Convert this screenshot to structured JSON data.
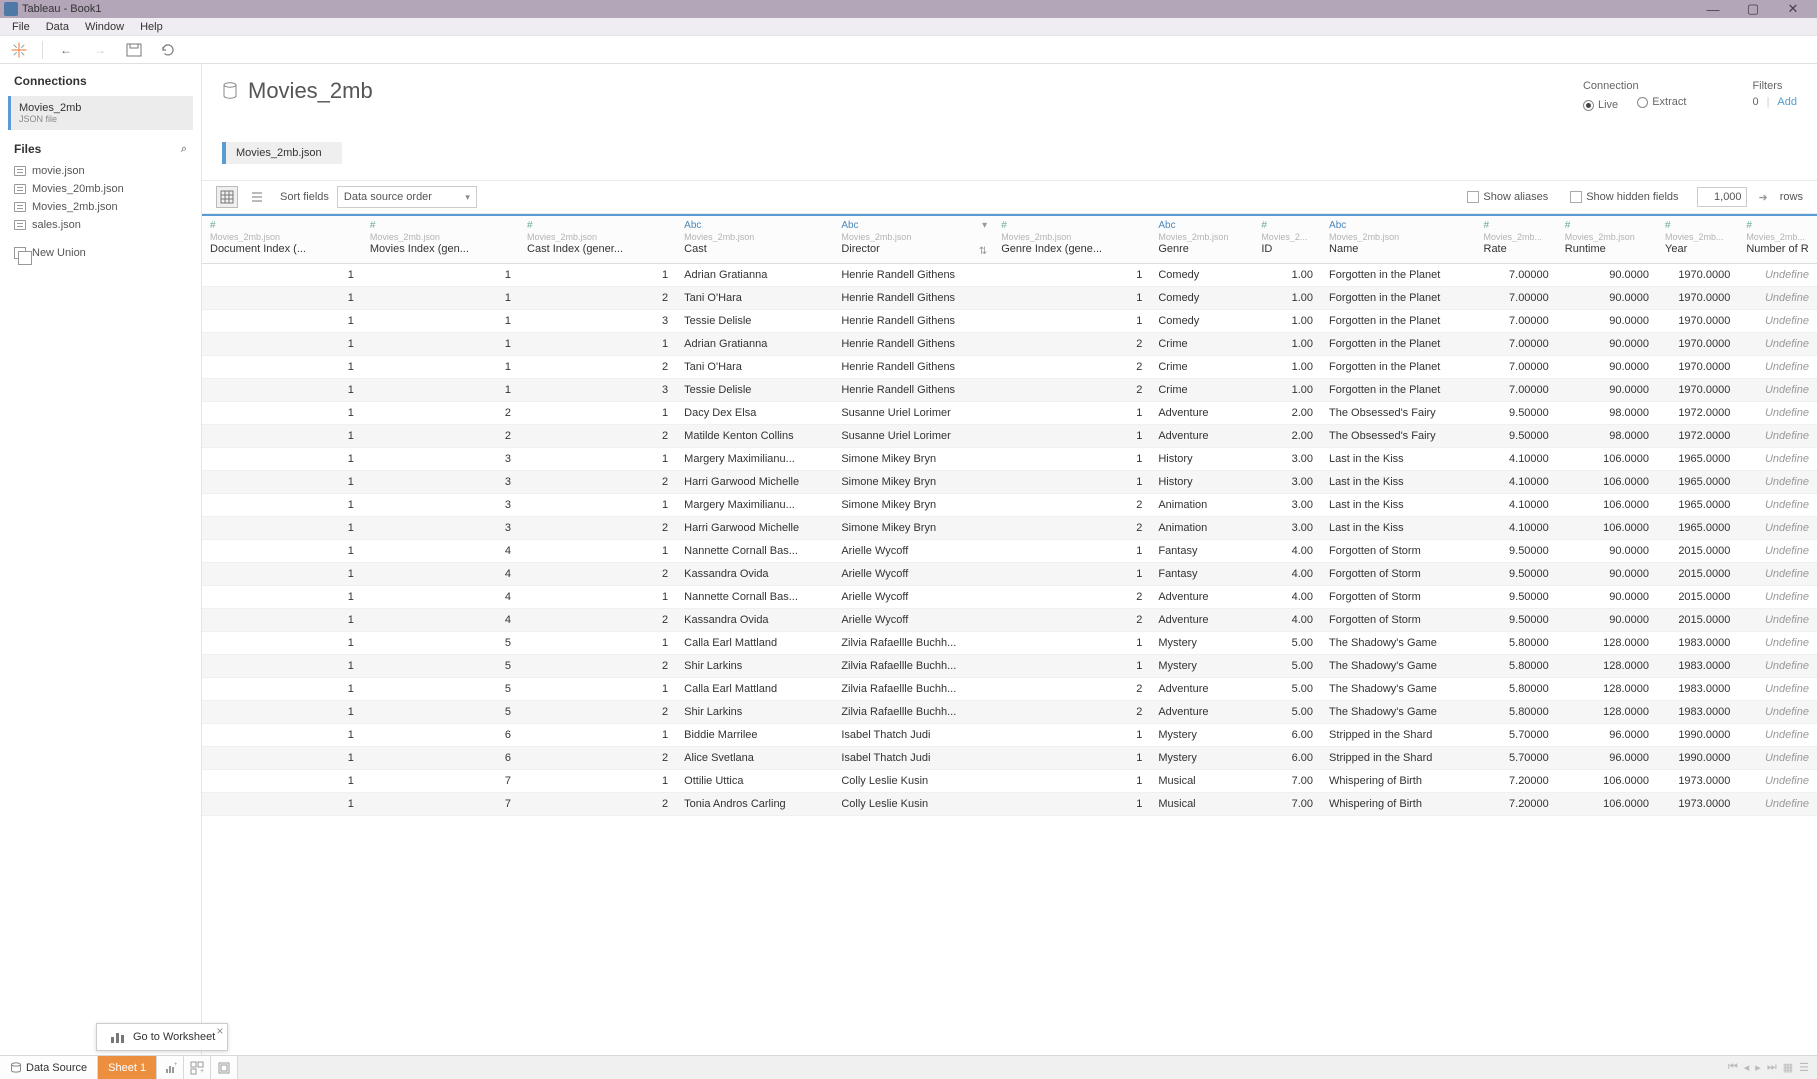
{
  "titlebar": {
    "title": "Tableau - Book1"
  },
  "menubar": [
    "File",
    "Data",
    "Window",
    "Help"
  ],
  "sidebar": {
    "connections_label": "Connections",
    "connection": {
      "name": "Movies_2mb",
      "sub": "JSON file"
    },
    "files_label": "Files",
    "files": [
      "movie.json",
      "Movies_20mb.json",
      "Movies_2mb.json",
      "sales.json"
    ],
    "new_union": "New Union"
  },
  "canvas": {
    "title": "Movies_2mb",
    "connection_label": "Connection",
    "conn_live": "Live",
    "conn_extract": "Extract",
    "filters_label": "Filters",
    "filters_count": "0",
    "filters_add": "Add",
    "file_pill": "Movies_2mb.json"
  },
  "options": {
    "sort_fields": "Sort fields",
    "sort_value": "Data source order",
    "show_aliases": "Show aliases",
    "show_hidden": "Show hidden fields",
    "rows_value": "1,000",
    "rows_label": "rows"
  },
  "columns": [
    {
      "type": "num",
      "src": "Movies_2mb.json",
      "name": "Document Index (...",
      "align": "num",
      "cls": "c-docidx"
    },
    {
      "type": "num",
      "src": "Movies_2mb.json",
      "name": "Movies Index (gen...",
      "align": "num",
      "cls": "c-movidx"
    },
    {
      "type": "num",
      "src": "Movies_2mb.json",
      "name": "Cast Index (gener...",
      "align": "num",
      "cls": "c-castidx"
    },
    {
      "type": "str",
      "src": "Movies_2mb.json",
      "name": "Cast",
      "align": "txt",
      "cls": "c-cast"
    },
    {
      "type": "str",
      "src": "Movies_2mb.json",
      "name": "Director",
      "align": "txt",
      "cls": "c-director",
      "dropdown": true,
      "sort": true
    },
    {
      "type": "num",
      "src": "Movies_2mb.json",
      "name": "Genre Index (gene...",
      "align": "num",
      "cls": "c-genreidx"
    },
    {
      "type": "str",
      "src": "Movies_2mb.json",
      "name": "Genre",
      "align": "txt",
      "cls": "c-genre"
    },
    {
      "type": "num",
      "src": "Movies_2...",
      "name": "ID",
      "align": "num",
      "cls": "c-id"
    },
    {
      "type": "str",
      "src": "Movies_2mb.json",
      "name": "Name",
      "align": "txt",
      "cls": "c-name"
    },
    {
      "type": "num",
      "src": "Movies_2mb...",
      "name": "Rate",
      "align": "num",
      "cls": "c-rate"
    },
    {
      "type": "num",
      "src": "Movies_2mb.json",
      "name": "Runtime",
      "align": "num",
      "cls": "c-runtime"
    },
    {
      "type": "num",
      "src": "Movies_2mb...",
      "name": "Year",
      "align": "num",
      "cls": "c-year"
    },
    {
      "type": "num",
      "src": "Movies_2mb...",
      "name": "Number of R",
      "align": "num",
      "cls": "c-numr"
    }
  ],
  "rows": [
    [
      "1",
      "1",
      "1",
      "Adrian Gratianna",
      "Henrie Randell Githens",
      "1",
      "Comedy",
      "1.00",
      "Forgotten in the Planet",
      "7.00000",
      "90.0000",
      "1970.0000",
      "Undefine"
    ],
    [
      "1",
      "1",
      "2",
      "Tani O'Hara",
      "Henrie Randell Githens",
      "1",
      "Comedy",
      "1.00",
      "Forgotten in the Planet",
      "7.00000",
      "90.0000",
      "1970.0000",
      "Undefine"
    ],
    [
      "1",
      "1",
      "3",
      "Tessie Delisle",
      "Henrie Randell Githens",
      "1",
      "Comedy",
      "1.00",
      "Forgotten in the Planet",
      "7.00000",
      "90.0000",
      "1970.0000",
      "Undefine"
    ],
    [
      "1",
      "1",
      "1",
      "Adrian Gratianna",
      "Henrie Randell Githens",
      "2",
      "Crime",
      "1.00",
      "Forgotten in the Planet",
      "7.00000",
      "90.0000",
      "1970.0000",
      "Undefine"
    ],
    [
      "1",
      "1",
      "2",
      "Tani O'Hara",
      "Henrie Randell Githens",
      "2",
      "Crime",
      "1.00",
      "Forgotten in the Planet",
      "7.00000",
      "90.0000",
      "1970.0000",
      "Undefine"
    ],
    [
      "1",
      "1",
      "3",
      "Tessie Delisle",
      "Henrie Randell Githens",
      "2",
      "Crime",
      "1.00",
      "Forgotten in the Planet",
      "7.00000",
      "90.0000",
      "1970.0000",
      "Undefine"
    ],
    [
      "1",
      "2",
      "1",
      "Dacy Dex Elsa",
      "Susanne Uriel Lorimer",
      "1",
      "Adventure",
      "2.00",
      "The Obsessed's Fairy",
      "9.50000",
      "98.0000",
      "1972.0000",
      "Undefine"
    ],
    [
      "1",
      "2",
      "2",
      "Matilde Kenton Collins",
      "Susanne Uriel Lorimer",
      "1",
      "Adventure",
      "2.00",
      "The Obsessed's Fairy",
      "9.50000",
      "98.0000",
      "1972.0000",
      "Undefine"
    ],
    [
      "1",
      "3",
      "1",
      "Margery Maximilianu...",
      "Simone Mikey Bryn",
      "1",
      "History",
      "3.00",
      "Last in the Kiss",
      "4.10000",
      "106.0000",
      "1965.0000",
      "Undefine"
    ],
    [
      "1",
      "3",
      "2",
      "Harri Garwood Michelle",
      "Simone Mikey Bryn",
      "1",
      "History",
      "3.00",
      "Last in the Kiss",
      "4.10000",
      "106.0000",
      "1965.0000",
      "Undefine"
    ],
    [
      "1",
      "3",
      "1",
      "Margery Maximilianu...",
      "Simone Mikey Bryn",
      "2",
      "Animation",
      "3.00",
      "Last in the Kiss",
      "4.10000",
      "106.0000",
      "1965.0000",
      "Undefine"
    ],
    [
      "1",
      "3",
      "2",
      "Harri Garwood Michelle",
      "Simone Mikey Bryn",
      "2",
      "Animation",
      "3.00",
      "Last in the Kiss",
      "4.10000",
      "106.0000",
      "1965.0000",
      "Undefine"
    ],
    [
      "1",
      "4",
      "1",
      "Nannette Cornall Bas...",
      "Arielle Wycoff",
      "1",
      "Fantasy",
      "4.00",
      "Forgotten of Storm",
      "9.50000",
      "90.0000",
      "2015.0000",
      "Undefine"
    ],
    [
      "1",
      "4",
      "2",
      "Kassandra Ovida",
      "Arielle Wycoff",
      "1",
      "Fantasy",
      "4.00",
      "Forgotten of Storm",
      "9.50000",
      "90.0000",
      "2015.0000",
      "Undefine"
    ],
    [
      "1",
      "4",
      "1",
      "Nannette Cornall Bas...",
      "Arielle Wycoff",
      "2",
      "Adventure",
      "4.00",
      "Forgotten of Storm",
      "9.50000",
      "90.0000",
      "2015.0000",
      "Undefine"
    ],
    [
      "1",
      "4",
      "2",
      "Kassandra Ovida",
      "Arielle Wycoff",
      "2",
      "Adventure",
      "4.00",
      "Forgotten of Storm",
      "9.50000",
      "90.0000",
      "2015.0000",
      "Undefine"
    ],
    [
      "1",
      "5",
      "1",
      "Calla Earl Mattland",
      "Zilvia Rafaellle Buchh...",
      "1",
      "Mystery",
      "5.00",
      "The Shadowy's Game",
      "5.80000",
      "128.0000",
      "1983.0000",
      "Undefine"
    ],
    [
      "1",
      "5",
      "2",
      "Shir Larkins",
      "Zilvia Rafaellle Buchh...",
      "1",
      "Mystery",
      "5.00",
      "The Shadowy's Game",
      "5.80000",
      "128.0000",
      "1983.0000",
      "Undefine"
    ],
    [
      "1",
      "5",
      "1",
      "Calla Earl Mattland",
      "Zilvia Rafaellle Buchh...",
      "2",
      "Adventure",
      "5.00",
      "The Shadowy's Game",
      "5.80000",
      "128.0000",
      "1983.0000",
      "Undefine"
    ],
    [
      "1",
      "5",
      "2",
      "Shir Larkins",
      "Zilvia Rafaellle Buchh...",
      "2",
      "Adventure",
      "5.00",
      "The Shadowy's Game",
      "5.80000",
      "128.0000",
      "1983.0000",
      "Undefine"
    ],
    [
      "1",
      "6",
      "1",
      "Biddie Marrilee",
      "Isabel Thatch Judi",
      "1",
      "Mystery",
      "6.00",
      "Stripped in the Shard",
      "5.70000",
      "96.0000",
      "1990.0000",
      "Undefine"
    ],
    [
      "1",
      "6",
      "2",
      "Alice Svetlana",
      "Isabel Thatch Judi",
      "1",
      "Mystery",
      "6.00",
      "Stripped in the Shard",
      "5.70000",
      "96.0000",
      "1990.0000",
      "Undefine"
    ],
    [
      "1",
      "7",
      "1",
      "Ottilie Uttica",
      "Colly Leslie Kusin",
      "1",
      "Musical",
      "7.00",
      "Whispering of Birth",
      "7.20000",
      "106.0000",
      "1973.0000",
      "Undefine"
    ],
    [
      "1",
      "7",
      "2",
      "Tonia Andros Carling",
      "Colly Leslie Kusin",
      "1",
      "Musical",
      "7.00",
      "Whispering of Birth",
      "7.20000",
      "106.0000",
      "1973.0000",
      "Undefine"
    ]
  ],
  "go_ws": "Go to Worksheet",
  "tabs": {
    "data_source": "Data Source",
    "sheet1": "Sheet 1"
  }
}
